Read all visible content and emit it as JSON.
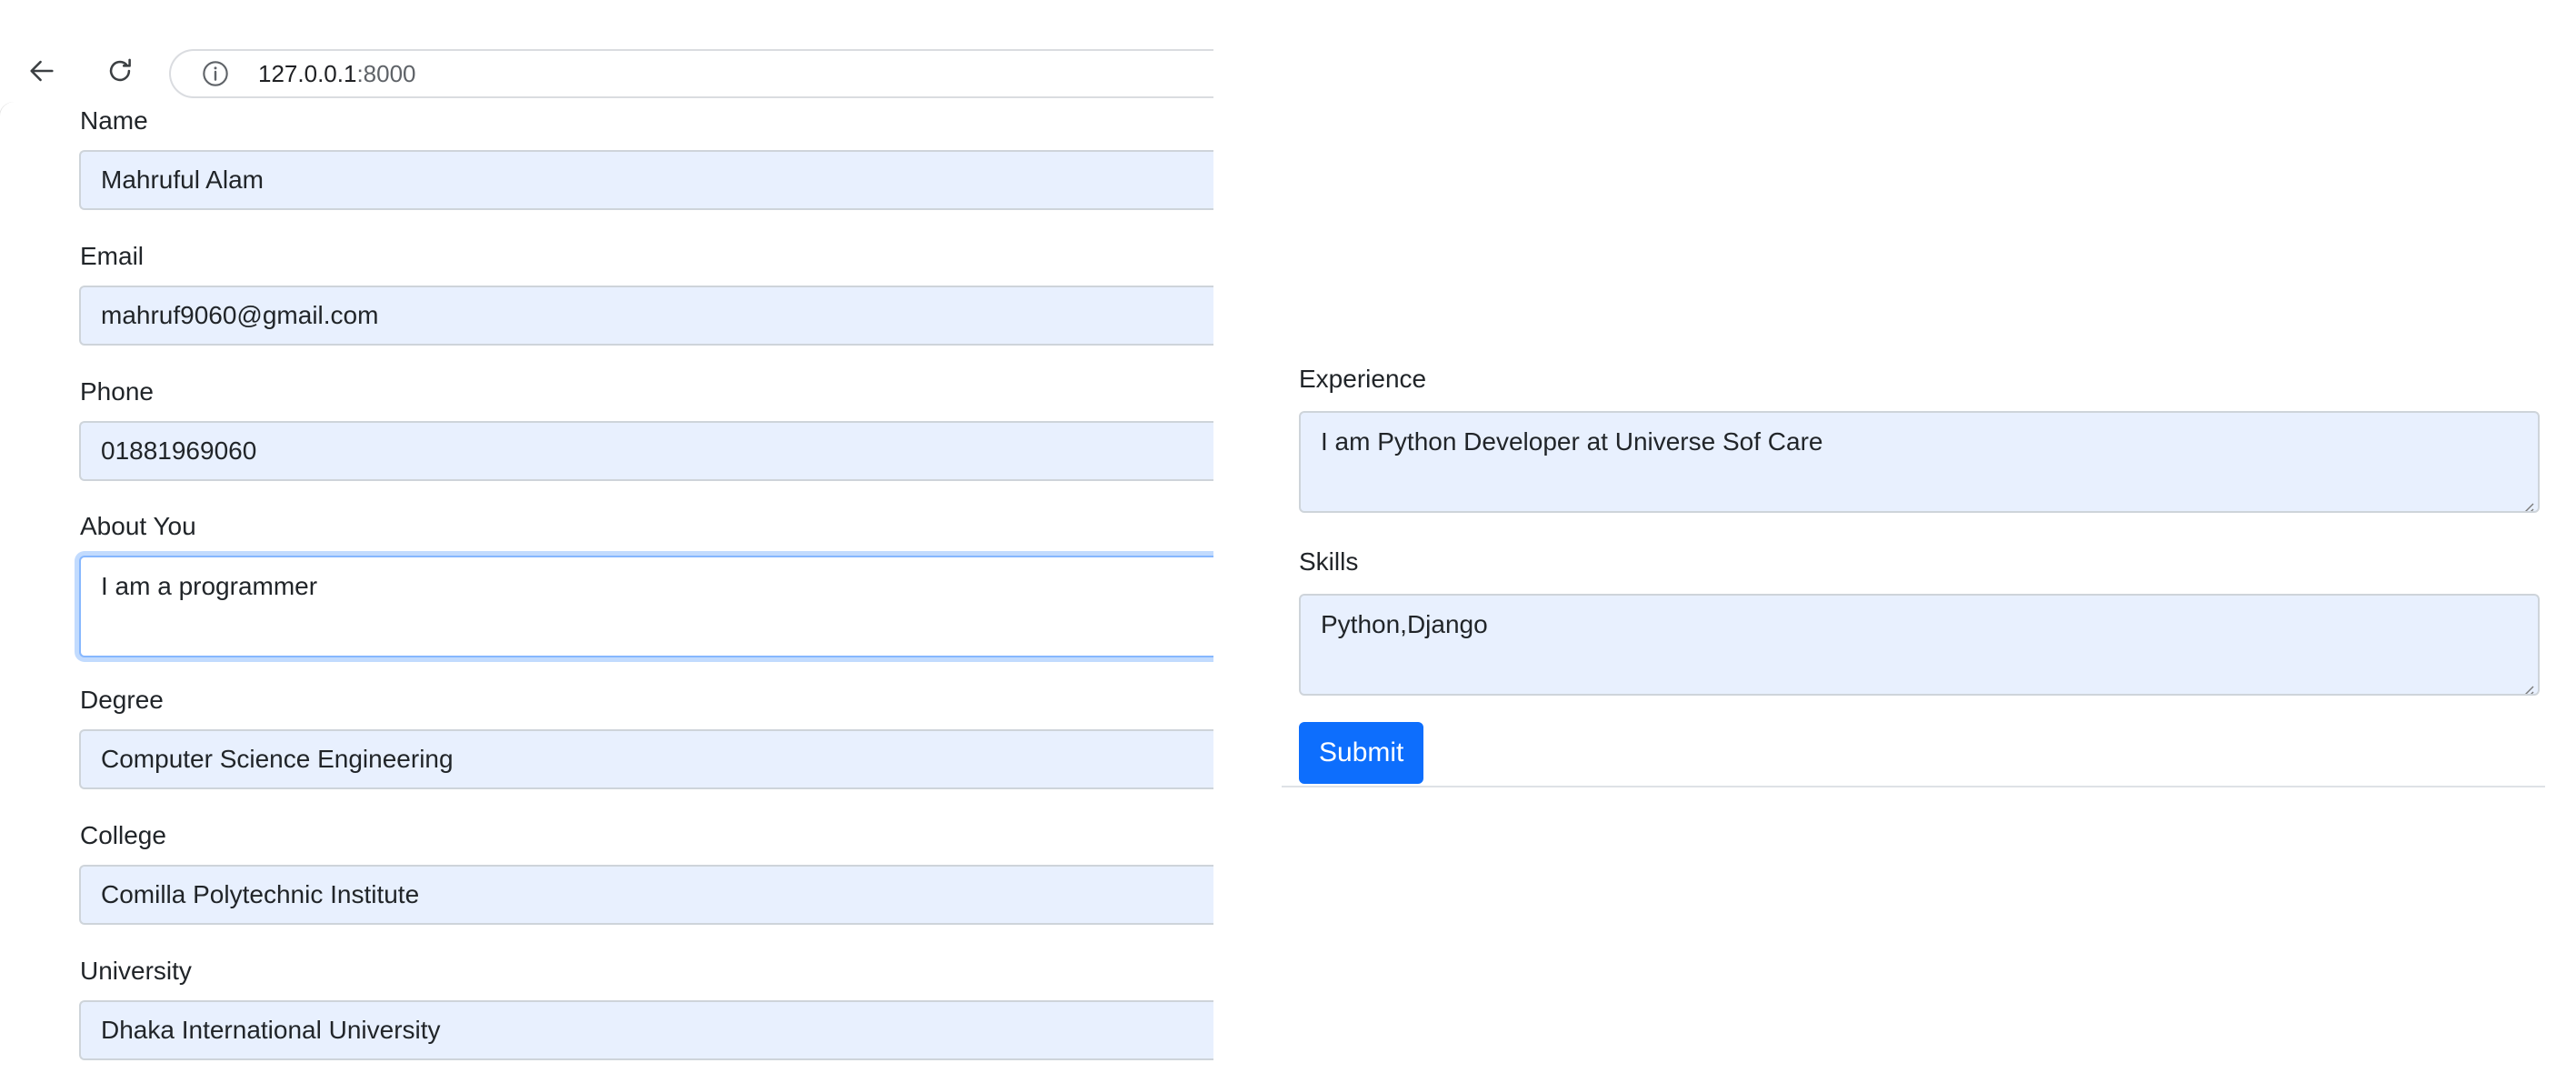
{
  "browser": {
    "url_host": "127.0.0.1",
    "url_port": ":8000",
    "back_icon": "arrow-left-icon",
    "reload_icon": "reload-icon",
    "info_icon": "info-icon"
  },
  "form_left": {
    "name": {
      "label": "Name",
      "value": "Mahruful Alam"
    },
    "email": {
      "label": "Email",
      "value": "mahruf9060@gmail.com"
    },
    "phone": {
      "label": "Phone",
      "value": "01881969060"
    },
    "about": {
      "label": "About You",
      "value": "I am a programmer"
    },
    "degree": {
      "label": "Degree",
      "value": "Computer Science Engineering"
    },
    "college": {
      "label": "College",
      "value": "Comilla Polytechnic Institute"
    },
    "university": {
      "label": "University",
      "value": "Dhaka International University"
    }
  },
  "form_right": {
    "experience": {
      "label": "Experience",
      "value": "I am Python Developer at Universe Sof Care"
    },
    "skills": {
      "label": "Skills",
      "value": "Python,Django"
    },
    "submit_label": "Submit"
  },
  "colors": {
    "input_autofill_bg": "#e8f0fe",
    "primary_button": "#0d6efd",
    "focus_border": "#86b7fe"
  }
}
